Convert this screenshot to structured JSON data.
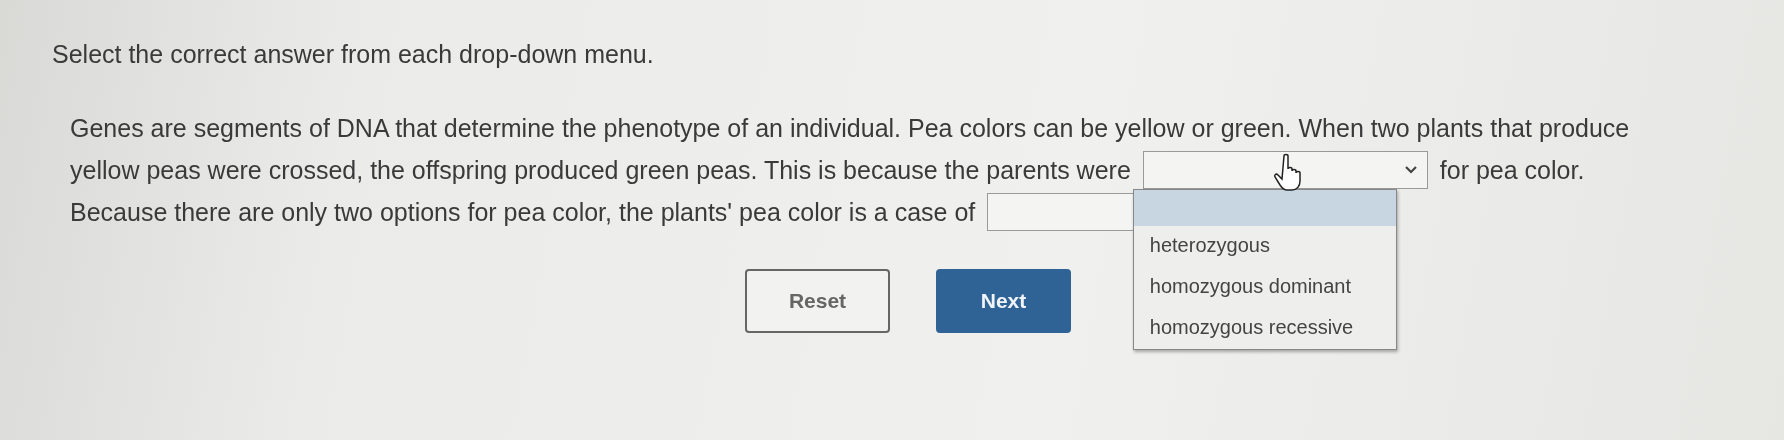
{
  "instruction": "Select the correct answer from each drop-down menu.",
  "passage": {
    "line_1": "Genes are segments of DNA that determine the phenotype of an individual. Pea colors can be yellow or green. When two plants that produce",
    "line_2_before": "yellow peas were crossed, the offspring produced green peas. This is because the parents were",
    "dropdown_1": {
      "expanded": true,
      "blank_option_highlighted": true,
      "options": [
        {
          "label": "heterozygous",
          "selected": false
        },
        {
          "label": "homozygous dominant",
          "selected": false
        },
        {
          "label": "homozygous recessive",
          "selected": false
        }
      ]
    },
    "line_2_after": "for pea color.",
    "line_3_before": "Because there are only two options for pea color, the plants' pea color is a case of",
    "dropdown_2": {
      "expanded": false
    }
  },
  "buttons": [
    {
      "label": "Reset",
      "kind": "outline"
    },
    {
      "label": "Next",
      "kind": "primary"
    }
  ]
}
